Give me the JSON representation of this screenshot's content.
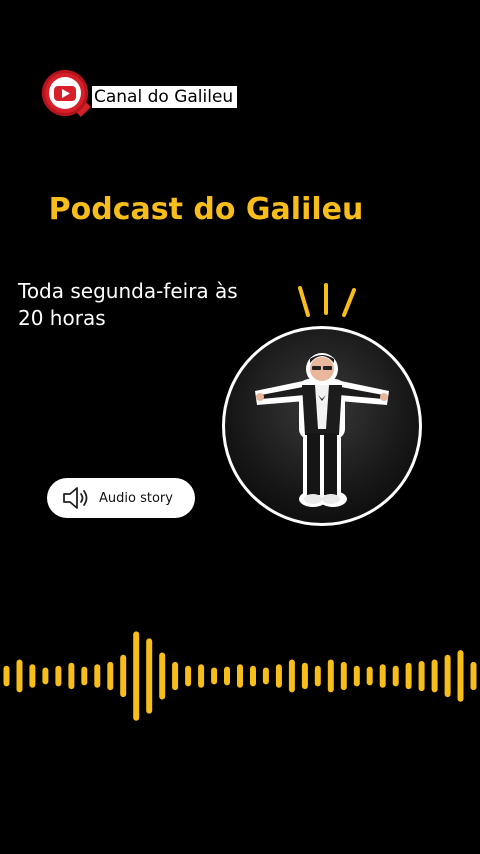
{
  "brand": {
    "channel_name": "Canal do Galileu",
    "icon": "youtube-play-icon",
    "badge_color": "#d71f2a"
  },
  "title": "Podcast do Galileu",
  "schedule": {
    "line1": "Toda segunda-feira às",
    "line2": "20 horas"
  },
  "host_photo": {
    "icon": "host-portrait"
  },
  "audio_button": {
    "label": "Audio story",
    "icon": "speaker-icon"
  },
  "waveform": {
    "color": "#f6bd1b",
    "levels": [
      0.22,
      0.35,
      0.25,
      0.18,
      0.22,
      0.28,
      0.2,
      0.25,
      0.3,
      0.45,
      0.95,
      0.8,
      0.5,
      0.3,
      0.22,
      0.25,
      0.18,
      0.2,
      0.25,
      0.22,
      0.18,
      0.25,
      0.35,
      0.28,
      0.22,
      0.35,
      0.3,
      0.22,
      0.2,
      0.25,
      0.22,
      0.28,
      0.32,
      0.35,
      0.45,
      0.55,
      0.3
    ]
  },
  "colors": {
    "accent": "#f6bd1b",
    "background": "#000000"
  }
}
